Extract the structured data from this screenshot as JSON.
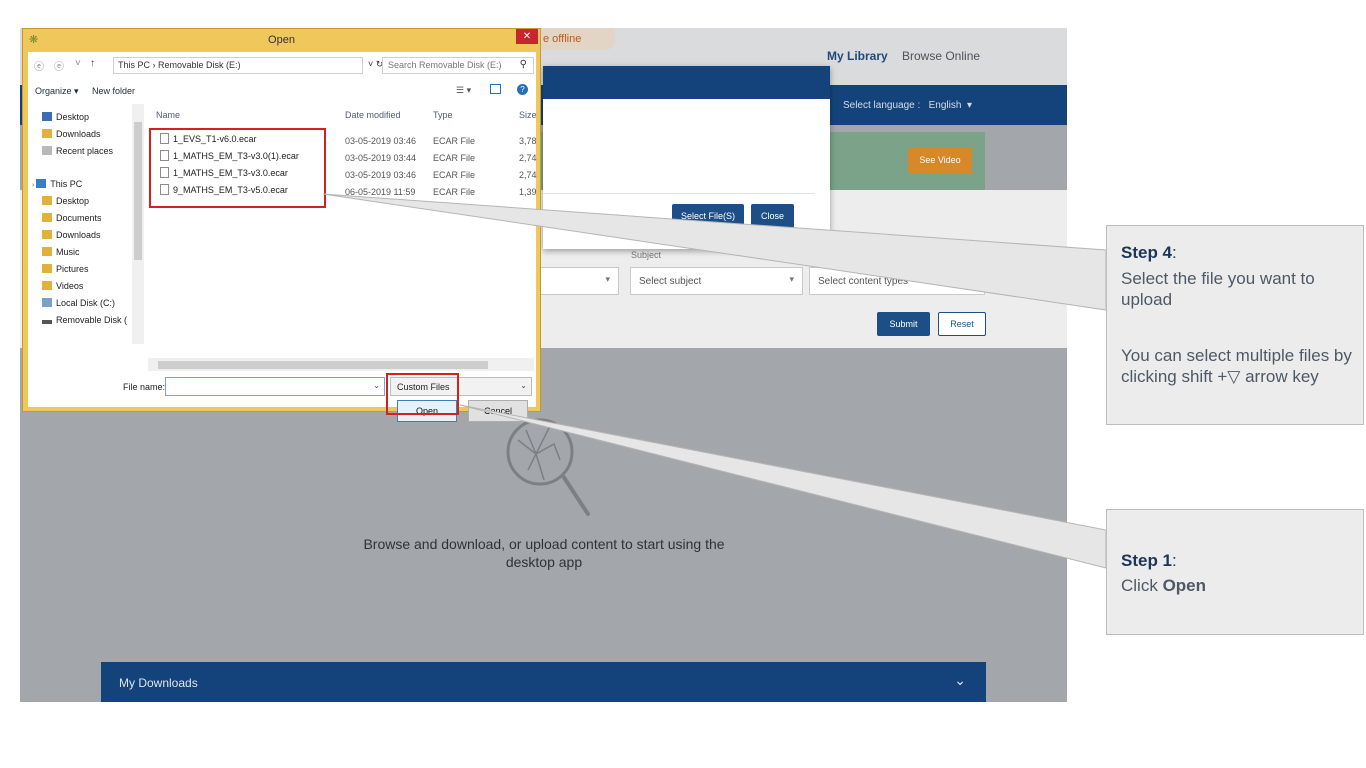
{
  "app": {
    "nav": {
      "my_library": "My Library",
      "browse_online": "Browse Online"
    },
    "offline_tab": "e offline",
    "language_label": "Select language :",
    "language_value": "English",
    "see_video": "See Video",
    "filters": {
      "subject_label": "Subject",
      "subject_placeholder": "Select subject",
      "content_types_placeholder": "Select content types",
      "submit": "Submit",
      "reset": "Reset"
    },
    "empty_message": "Browse and download, or upload content to start using the desktop app",
    "downloads_bar": "My Downloads",
    "upload_dialog": {
      "select_files": "Select File(S)",
      "close": "Close"
    }
  },
  "open_dialog": {
    "title": "Open",
    "address": "This PC  ›  Removable Disk (E:)",
    "search_placeholder": "Search Removable Disk (E:)",
    "organize": "Organize ▾",
    "new_folder": "New folder",
    "nav_items": [
      "Desktop",
      "Downloads",
      "Recent places",
      "This PC",
      "Desktop",
      "Documents",
      "Downloads",
      "Music",
      "Pictures",
      "Videos",
      "Local Disk (C:)",
      "Removable Disk ("
    ],
    "columns": [
      "Name",
      "Date modified",
      "Type",
      "Size"
    ],
    "files": [
      {
        "name": "1_EVS_T1-v6.0.ecar",
        "date": "03-05-2019 03:46",
        "type": "ECAR File",
        "size": "3,78"
      },
      {
        "name": "1_MATHS_EM_T3-v3.0(1).ecar",
        "date": "03-05-2019 03:44",
        "type": "ECAR File",
        "size": "2,74"
      },
      {
        "name": "1_MATHS_EM_T3-v3.0.ecar",
        "date": "03-05-2019 03:46",
        "type": "ECAR File",
        "size": "2,74"
      },
      {
        "name": "9_MATHS_EM_T3-v5.0.ecar",
        "date": "06-05-2019 11:59",
        "type": "ECAR File",
        "size": "1,39"
      }
    ],
    "file_name_label": "File name:",
    "filter_value": "Custom Files",
    "open_button": "Open",
    "cancel_button": "Cancel"
  },
  "callouts": {
    "step4": {
      "step": "Step 4",
      "text1": "Select the file you want to upload",
      "text2": "You can select multiple files by clicking shift +▽ arrow key"
    },
    "step1": {
      "step": "Step 1",
      "text_prefix": "Click ",
      "text_bold": "Open"
    }
  },
  "colors": {
    "brand_blue": "#13437a",
    "highlight_red": "#d42020",
    "dialog_frame": "#f0c75a",
    "callout_bg": "#ececec"
  }
}
